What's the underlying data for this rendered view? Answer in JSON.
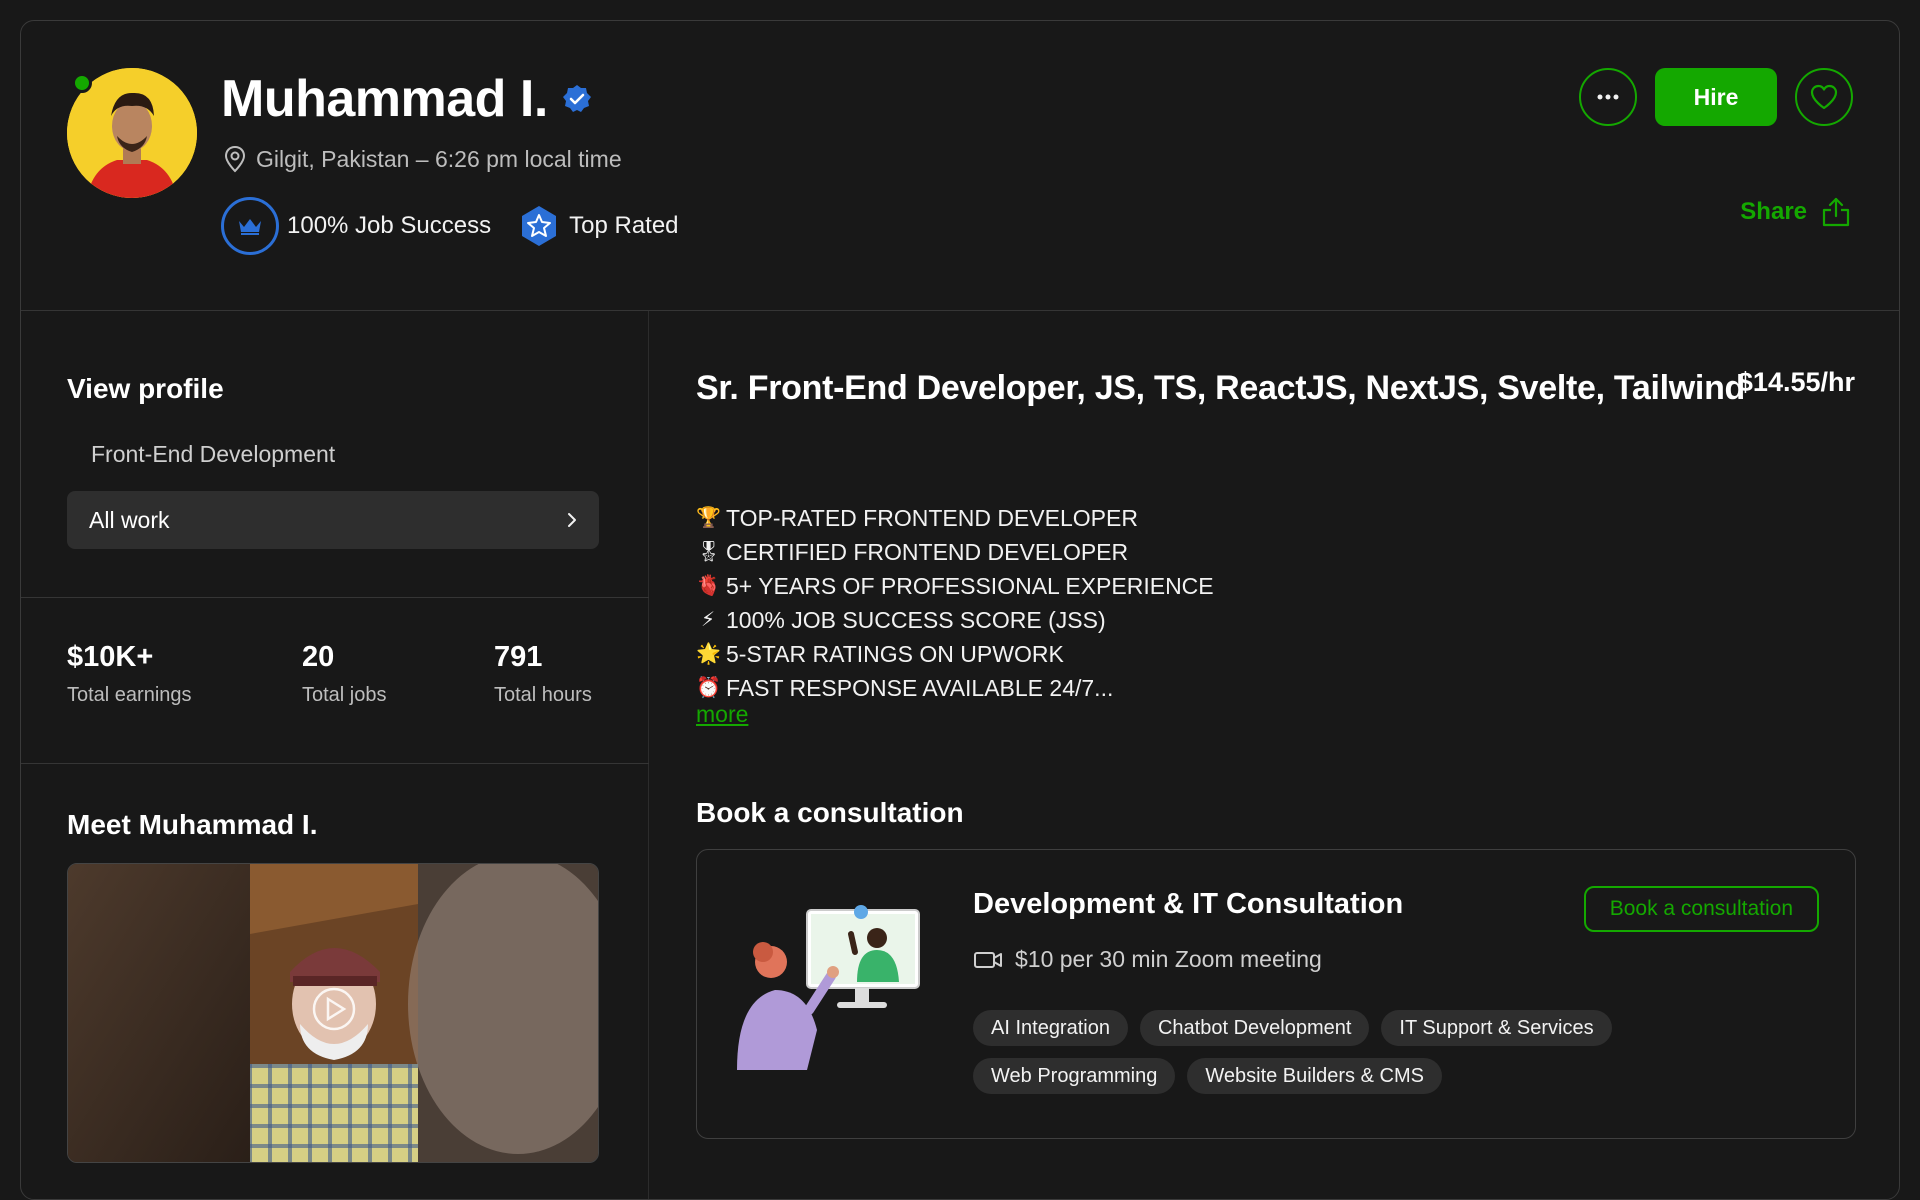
{
  "profile": {
    "name": "Muhammad I.",
    "location": "Gilgit, Pakistan – 6:26 pm local time",
    "job_success": "100% Job Success",
    "top_rated": "Top Rated",
    "hire_label": "Hire",
    "share_label": "Share"
  },
  "left": {
    "view_profile_title": "View profile",
    "specialization": "Front-End Development",
    "all_work": "All work",
    "stats": [
      {
        "value": "$10K+",
        "label": "Total earnings"
      },
      {
        "value": "20",
        "label": "Total jobs"
      },
      {
        "value": "791",
        "label": "Total hours"
      }
    ],
    "meet_title": "Meet Muhammad I."
  },
  "right": {
    "headline": "Sr. Front-End Developer, JS, TS, ReactJS, NextJS, Svelte, Tailwind",
    "rate": "$14.55/hr",
    "bullets": [
      {
        "icon": "🏆",
        "text": "TOP-RATED FRONTEND DEVELOPER"
      },
      {
        "icon": "🎖",
        "text": "CERTIFIED FRONTEND DEVELOPER"
      },
      {
        "icon": "🫀",
        "text": "5+ YEARS OF PROFESSIONAL EXPERIENCE"
      },
      {
        "icon": "⚡",
        "text": "100% JOB SUCCESS SCORE (JSS)"
      },
      {
        "icon": "🌟",
        "text": "5-STAR RATINGS ON UPWORK"
      },
      {
        "icon": "⏰",
        "text": "FAST RESPONSE AVAILABLE 24/7..."
      }
    ],
    "more_label": "more",
    "consultation_title": "Book a consultation",
    "consultation": {
      "title": "Development & IT Consultation",
      "meta": "$10 per 30 min Zoom meeting",
      "book_label": "Book a consultation",
      "tags": [
        "AI Integration",
        "Chatbot Development",
        "IT Support & Services",
        "Web Programming",
        "Website Builders & CMS"
      ]
    }
  },
  "colors": {
    "accent_green": "#14a800",
    "background": "#181818",
    "verified_blue": "#2b6fd6"
  }
}
